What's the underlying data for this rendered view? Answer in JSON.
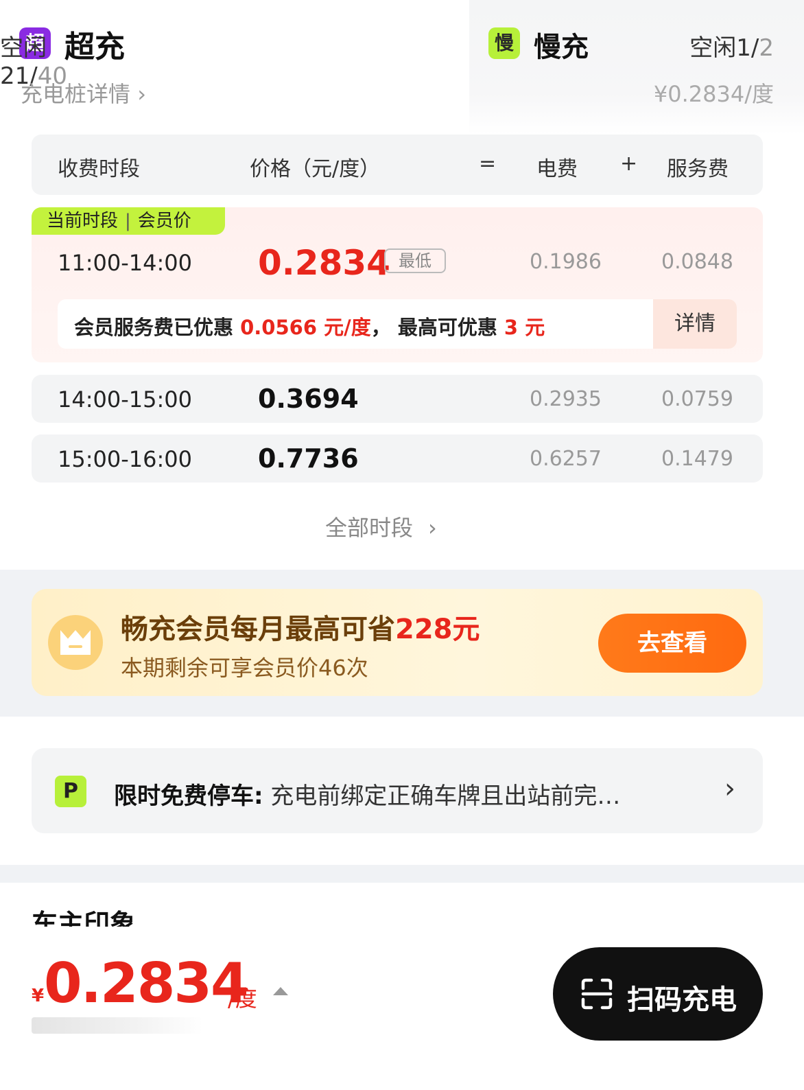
{
  "tabs": {
    "fast": {
      "badge": "超",
      "title": "超充",
      "idle_label": "空闲21/",
      "idle_total": "40",
      "link": "充电桩详情"
    },
    "slow": {
      "badge": "慢",
      "title": "慢充",
      "idle_label": "空闲1/",
      "idle_total": "2",
      "price": "¥0.2834/度"
    }
  },
  "table": {
    "headers": {
      "period": "收费时段",
      "price": "价格（元/度）",
      "eq": "=",
      "elec": "电费",
      "plus": "+",
      "service": "服务费"
    },
    "current": {
      "tag_a": "当前时段",
      "tag_sep": "|",
      "tag_b": "会员价",
      "time": "11:00-14:00",
      "price": "0.2834",
      "lowest": "最低",
      "elec": "0.1986",
      "service": "0.0848",
      "member_prefix": "会员服务费已优惠 ",
      "member_discount": "0.0566 元/度",
      "member_mid": "， 最高可优惠 ",
      "member_max": "3 元",
      "detail": "详情"
    },
    "rows": [
      {
        "time": "14:00-15:00",
        "price": "0.3694",
        "elec": "0.2935",
        "service": "0.0759"
      },
      {
        "time": "15:00-16:00",
        "price": "0.7736",
        "elec": "0.6257",
        "service": "0.1479"
      }
    ],
    "all_periods": "全部时段"
  },
  "promo": {
    "title_prefix": "畅充会员每月最高可省",
    "title_amount": "228元",
    "subtitle": "本期剩余可享会员价46次",
    "button": "去查看"
  },
  "parking": {
    "badge": "P",
    "label": "限时免费停车:",
    "text": " 充电前绑定正确车牌且出站前完…"
  },
  "bottom": {
    "peek_title": "车主印象",
    "currency": "¥",
    "price": "0.2834",
    "unit": "/度",
    "scan_button": "扫码充电"
  }
}
